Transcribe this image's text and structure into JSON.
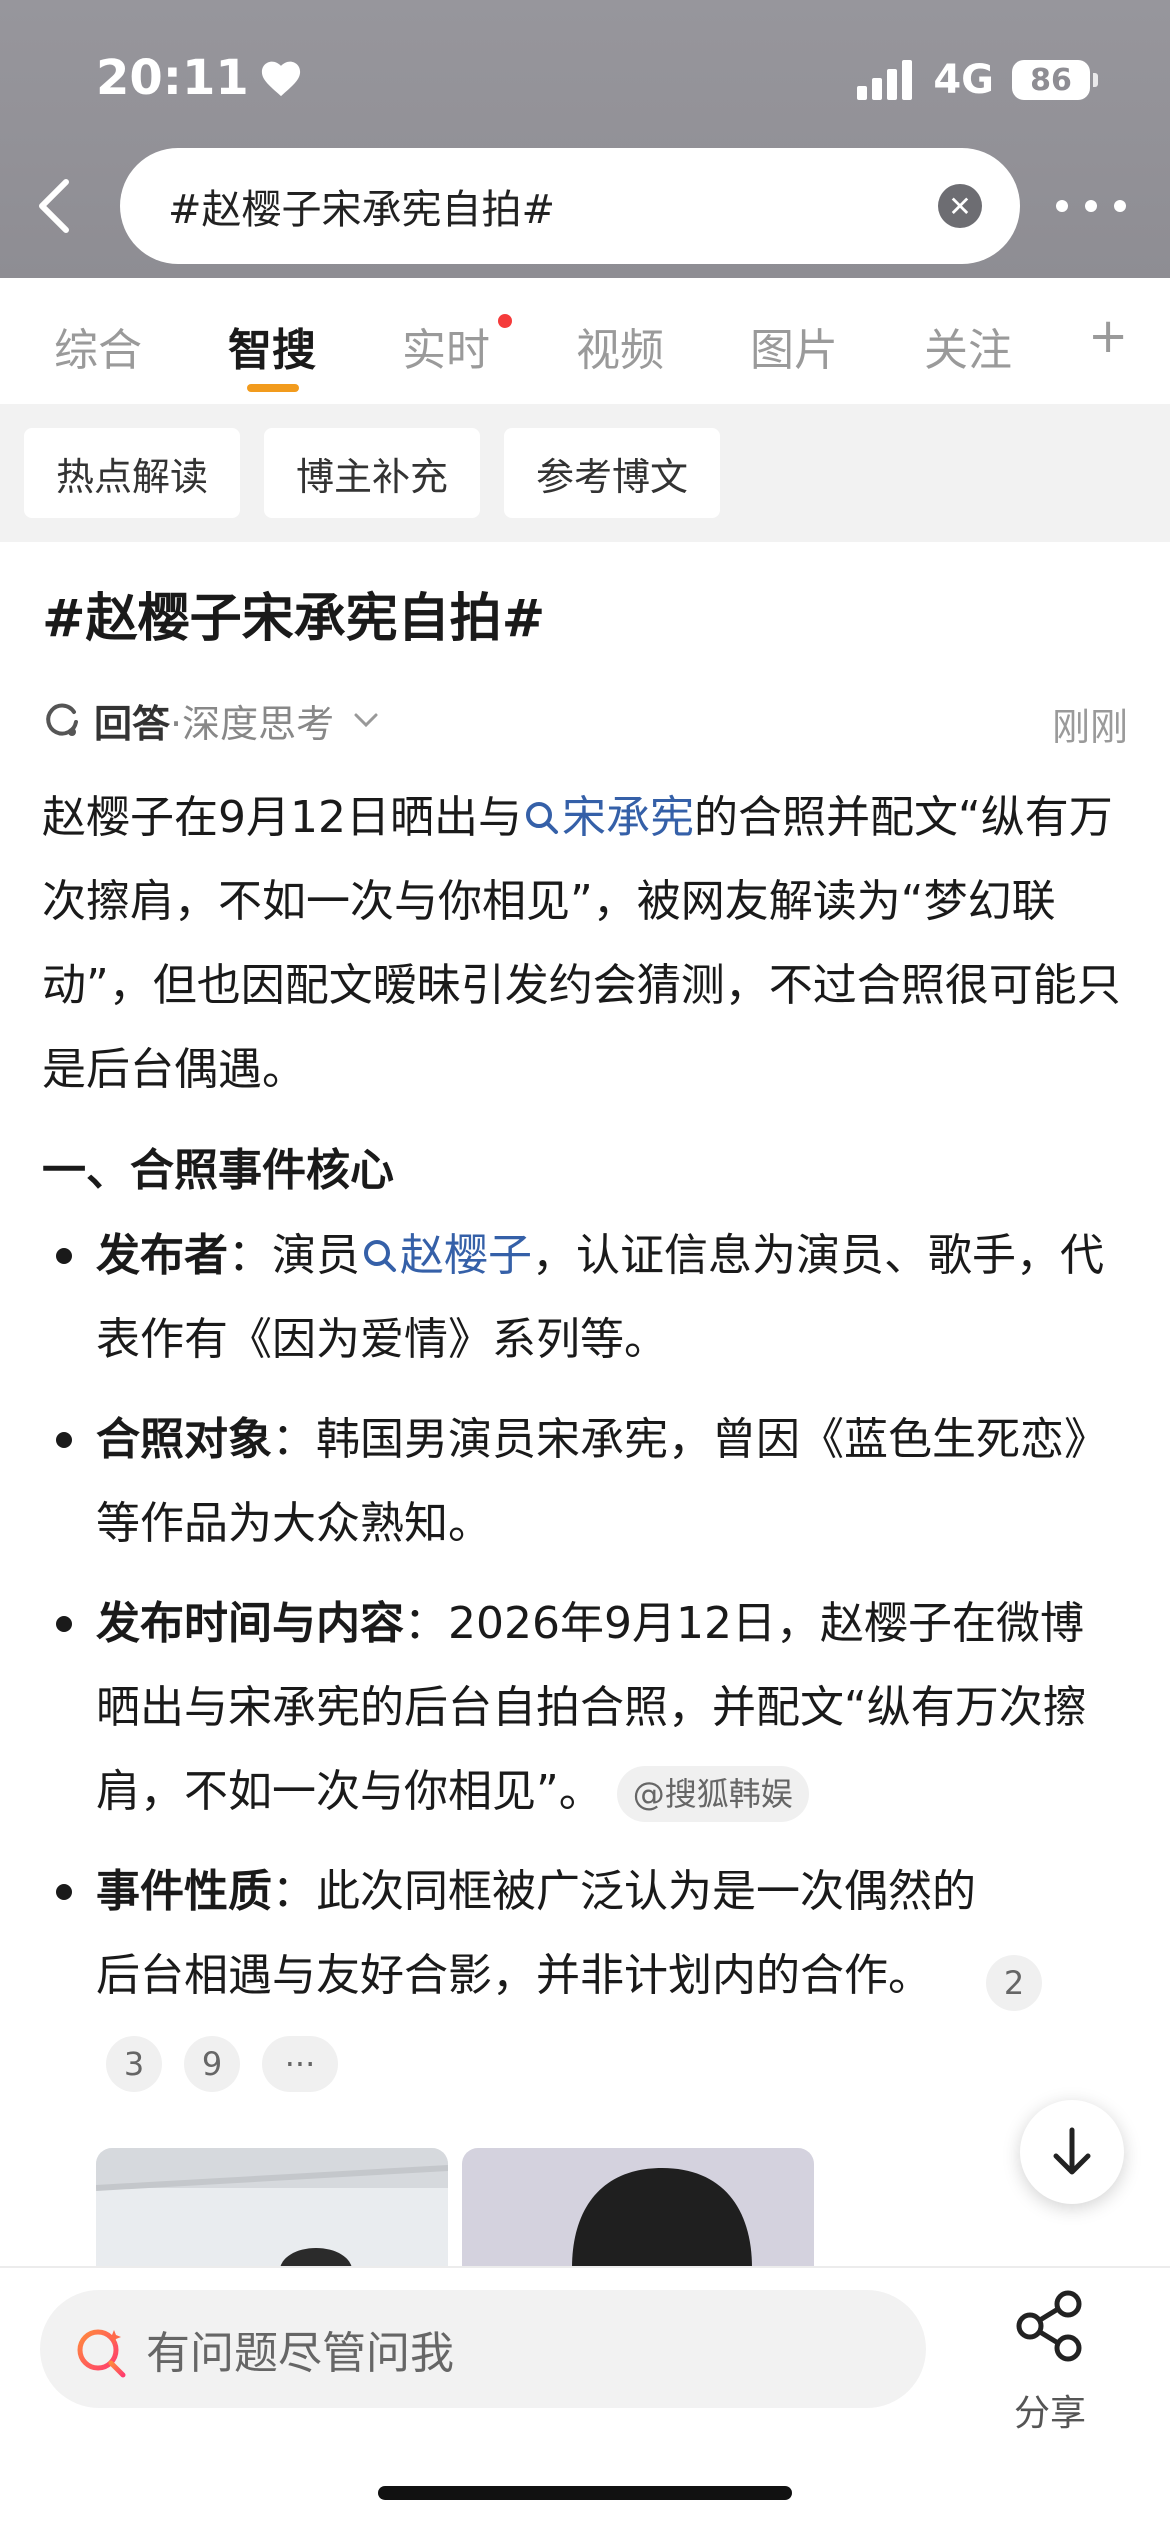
{
  "status": {
    "time": "20:11",
    "network": "4G",
    "battery": "86"
  },
  "search": {
    "query": "#赵樱子宋承宪自拍#"
  },
  "tabs": [
    "综合",
    "智搜",
    "实时",
    "视频",
    "图片",
    "关注",
    "+"
  ],
  "chips": [
    "热点解读",
    "博主补充",
    "参考博文"
  ],
  "article": {
    "title": "#赵樱子宋承宪自拍#",
    "meta_answer": "回答",
    "meta_mode": "·深度思考",
    "time": "刚刚",
    "intro_1": "赵樱子在9月12日晒出与",
    "intro_link": "宋承宪",
    "intro_2": "的合照并配文“纵有万次擦肩，不如一次与你相见”，被网友解读为“梦幻联动”，但也因配文暧昧引发约会猜测，不过合照很可能只是后台偶遇。",
    "heading": "一、合照事件核心",
    "b1_label": "发布者",
    "b1_pre": "：演员",
    "b1_link": "赵樱子",
    "b1_post": "，认证信息为演员、歌手，代表作有《因为爱情》系列等。",
    "b2_label": "合照对象",
    "b2_text": "：韩国男演员宋承宪，曾因《蓝色生死恋》等作品为大众熟知。",
    "b3_label": "发布时间与内容",
    "b3_text": "：2026年9月12日，赵樱子在微博晒出与宋承宪的后台自拍合照，并配文“纵有万次擦肩，不如一次与你相见”。",
    "b3_source": "@搜狐韩娱",
    "b4_label": "事件性质",
    "b4_text": "：此次同框被广泛认为是一次偶然的后台相遇与友好合影，并非计划内的合作。",
    "refs": [
      "2",
      "3",
      "9",
      "···"
    ]
  },
  "bottom": {
    "ask_placeholder": "有问题尽管问我",
    "share_label": "分享"
  }
}
